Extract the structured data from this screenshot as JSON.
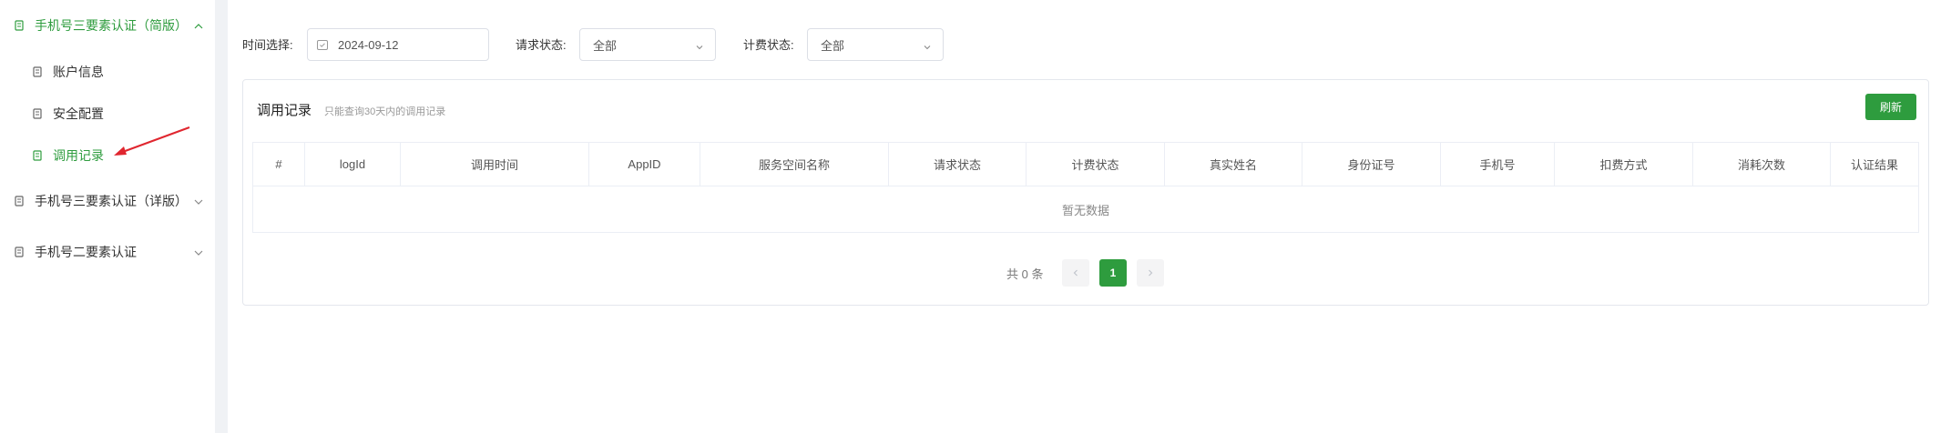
{
  "sidebar": {
    "groups": [
      {
        "label": "手机号三要素认证（简版）",
        "expanded": true,
        "active": true
      },
      {
        "label": "手机号三要素认证（详版）",
        "expanded": false,
        "active": false
      },
      {
        "label": "手机号二要素认证",
        "expanded": false,
        "active": false
      }
    ],
    "items": [
      {
        "label": "账户信息",
        "active": false
      },
      {
        "label": "安全配置",
        "active": false
      },
      {
        "label": "调用记录",
        "active": true
      }
    ],
    "icon": "document-icon"
  },
  "filters": {
    "time_label": "时间选择:",
    "time_value": "2024-09-12",
    "request_status_label": "请求状态:",
    "request_status_value": "全部",
    "billing_status_label": "计费状态:",
    "billing_status_value": "全部"
  },
  "card": {
    "title": "调用记录",
    "hint": "只能查询30天内的调用记录",
    "refresh_label": "刷新"
  },
  "table": {
    "columns": [
      "#",
      "logId",
      "调用时间",
      "AppID",
      "服务空间名称",
      "请求状态",
      "计费状态",
      "真实姓名",
      "身份证号",
      "手机号",
      "扣费方式",
      "消耗次数",
      "认证结果"
    ],
    "empty_text": "暂无数据"
  },
  "pagination": {
    "total_text": "共 0 条",
    "current_page": "1",
    "prev_icon": "chevron-left-icon",
    "next_icon": "chevron-right-icon"
  },
  "colors": {
    "accent": "#2e9c3e",
    "annotation": "#e0262f"
  }
}
